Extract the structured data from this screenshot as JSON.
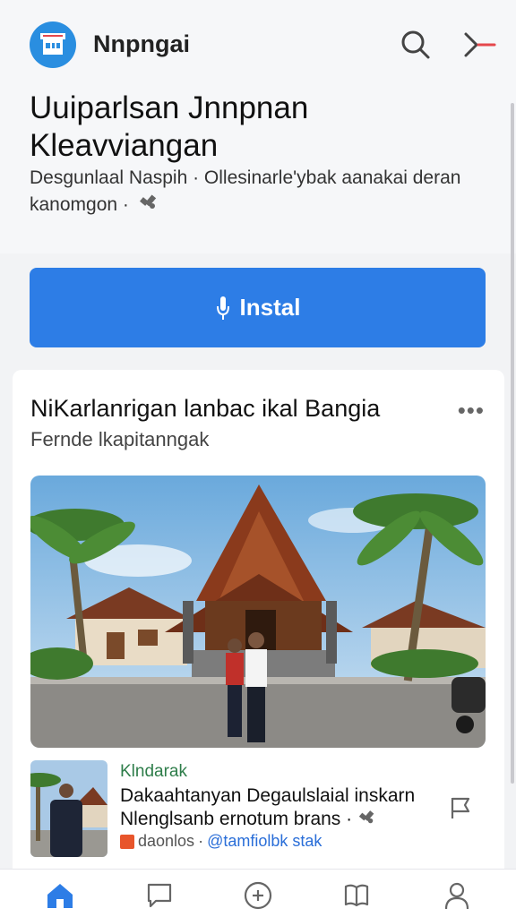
{
  "app": {
    "name": "Nnpngai",
    "logo_icon": "storefront-icon",
    "search_icon": "search-icon",
    "close_icon": "arrow-close-icon",
    "accent_color": "#2d7de6"
  },
  "header": {
    "title": "Uuiparlsan Jnnpnan Kleavviangan",
    "subtitle": "Desgunlaal Naspih · Ollesinarle'ybak aanakai deran kanomgon ·"
  },
  "install": {
    "label": "Instal",
    "icon": "microphone-icon"
  },
  "card": {
    "title": "NiKarlanrigan lanbac ikal Bangia",
    "subtitle": "Fernde lkapitanngak",
    "more_label": "•••",
    "hero_image": "traditional-house-photo"
  },
  "news": {
    "source": "Klndarak",
    "text": "Dakaahtanyan Degaulslaial inskarn Nlenglsanb ernotum brans ·",
    "meta_prefix": "daonlos",
    "meta_tag": "@tamfiolbk stak"
  },
  "bottom_nav": {
    "items": [
      {
        "name": "home",
        "icon": "home-icon"
      },
      {
        "name": "messages",
        "icon": "chat-icon"
      },
      {
        "name": "add",
        "icon": "plus-circle-icon"
      },
      {
        "name": "library",
        "icon": "book-icon"
      },
      {
        "name": "profile",
        "icon": "user-icon"
      }
    ]
  }
}
